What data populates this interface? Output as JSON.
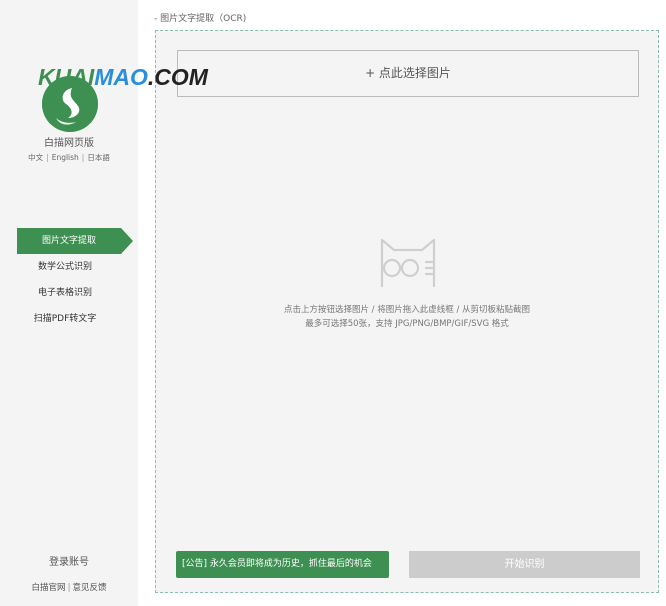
{
  "watermark": {
    "part1": "KUAI",
    "part2": "MAO",
    "part3": ".COM"
  },
  "app": {
    "name": "白描网页版",
    "languages": [
      "中文",
      "English",
      "日本語"
    ],
    "separator": "|"
  },
  "nav": {
    "items": [
      {
        "label": "图片文字提取",
        "active": true
      },
      {
        "label": "数学公式识别",
        "active": false
      },
      {
        "label": "电子表格识别",
        "active": false
      },
      {
        "label": "扫描PDF转文字",
        "active": false
      }
    ]
  },
  "sidebar_footer": {
    "login": "登录账号",
    "links": [
      "白描官网",
      "意见反馈"
    ],
    "separator": "|"
  },
  "main": {
    "title": "- 图片文字提取（OCR)",
    "select_button": "+ 点此选择图片",
    "hint_line1": "点击上方按钮选择图片 / 将图片拖入此虚线框 / 从剪切板粘贴截图",
    "hint_line2": "最多可选择50张，支持 JPG/PNG/BMP/GIF/SVG 格式",
    "notice": "[公告] 永久会员即将成为历史，抓住最后的机会",
    "start_button": "开始识别"
  },
  "colors": {
    "accent": "#3e8f52",
    "dashed_border": "#86c0a8",
    "disabled_button": "#cccccc",
    "panel_bg": "#f4f4f4"
  },
  "icons": {
    "logo": "baimiao-logo-icon",
    "empty_state": "cat-with-glasses-icon"
  }
}
